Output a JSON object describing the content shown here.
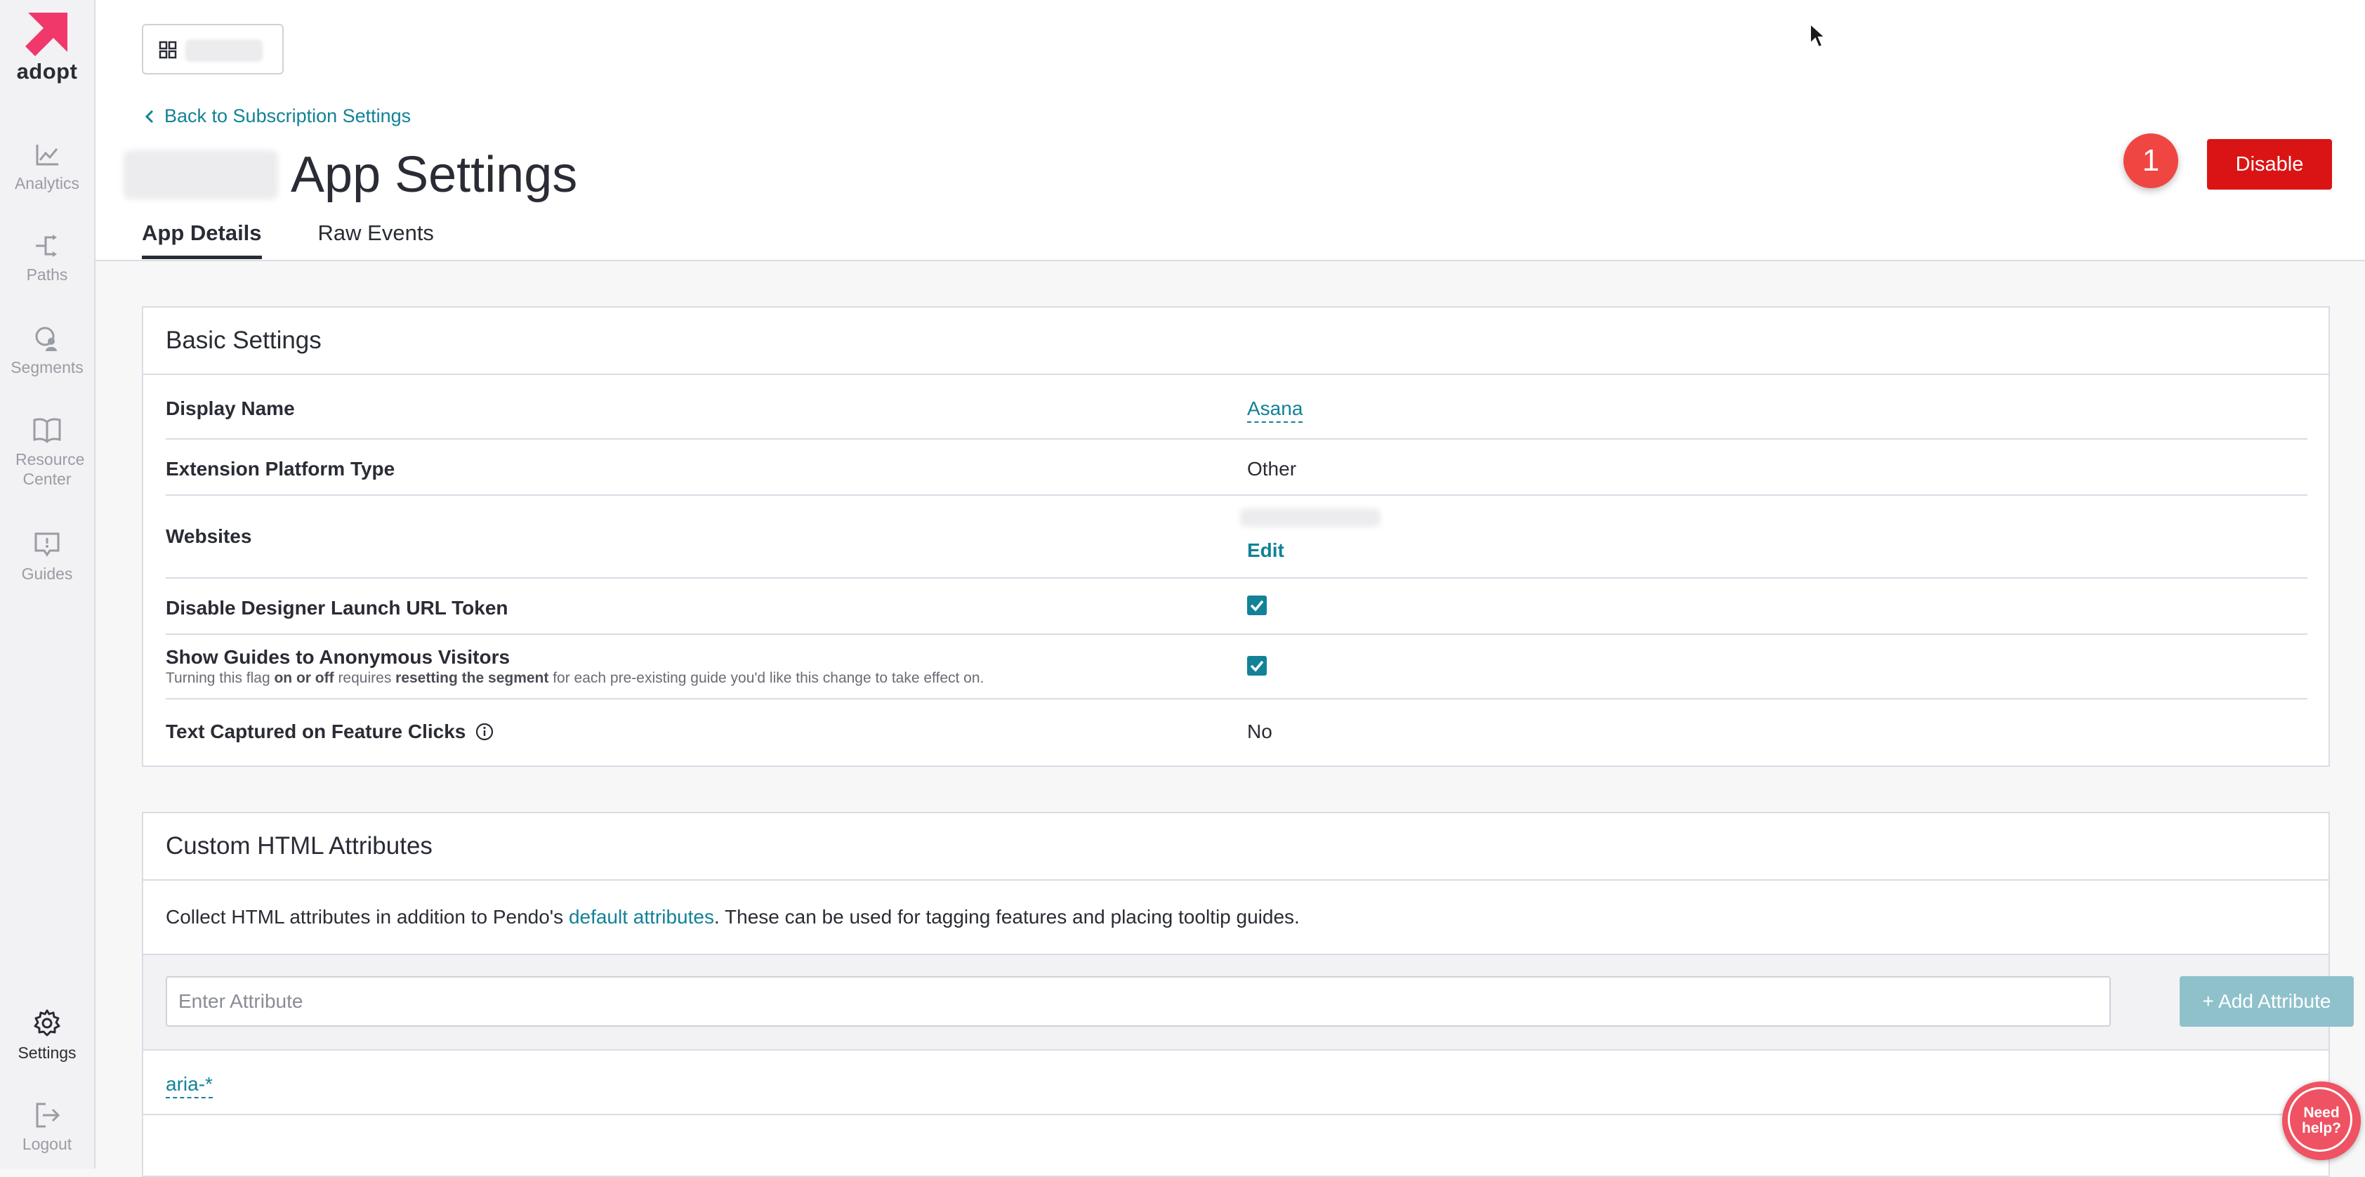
{
  "sidebar": {
    "logo_text": "adopt",
    "brand_color": "#f0386b",
    "items": [
      {
        "label": "Analytics",
        "icon": "chart-line-icon"
      },
      {
        "label": "Paths",
        "icon": "paths-icon"
      },
      {
        "label": "Segments",
        "icon": "segments-icon"
      },
      {
        "label": "Resource Center",
        "icon": "book-icon"
      },
      {
        "label": "Guides",
        "icon": "guides-icon"
      },
      {
        "label": "Settings",
        "icon": "gear-icon",
        "active": true
      },
      {
        "label": "Logout",
        "icon": "logout-icon"
      }
    ]
  },
  "header": {
    "back_link": "Back to Subscription Settings",
    "title": "App Settings",
    "tabs": [
      {
        "label": "App Details",
        "active": true
      },
      {
        "label": "Raw Events",
        "active": false
      }
    ],
    "badge": "1",
    "disable_button": "Disable"
  },
  "basic_settings": {
    "title": "Basic Settings",
    "rows": {
      "display_name": {
        "label": "Display Name",
        "value": "Asana"
      },
      "platform": {
        "label": "Extension Platform Type",
        "value": "Other"
      },
      "websites": {
        "label": "Websites",
        "edit": "Edit"
      },
      "designer_token": {
        "label": "Disable Designer Launch URL Token",
        "checked": true
      },
      "anonymous": {
        "label": "Show Guides to Anonymous Visitors",
        "sub_1": "Turning this flag ",
        "sub_2": "on or off",
        "sub_3": " requires ",
        "sub_4": "resetting the segment",
        "sub_5": " for each pre-existing guide you'd like this change to take effect on.",
        "checked": true
      },
      "text_captured": {
        "label": "Text Captured on Feature Clicks",
        "value": "No"
      }
    }
  },
  "custom_attributes": {
    "title": "Custom HTML Attributes",
    "desc_1": "Collect HTML attributes in addition to Pendo's ",
    "desc_link": "default attributes",
    "desc_2": ". These can be used for tagging features and placing tooltip guides.",
    "input_placeholder": "Enter Attribute",
    "add_button": "+ Add Attribute",
    "attributes": [
      "aria-*"
    ]
  },
  "help": {
    "label_1": "Need",
    "label_2": "help?"
  },
  "colors": {
    "accent": "#128297",
    "danger": "#da1414",
    "badge": "#ef4642"
  }
}
